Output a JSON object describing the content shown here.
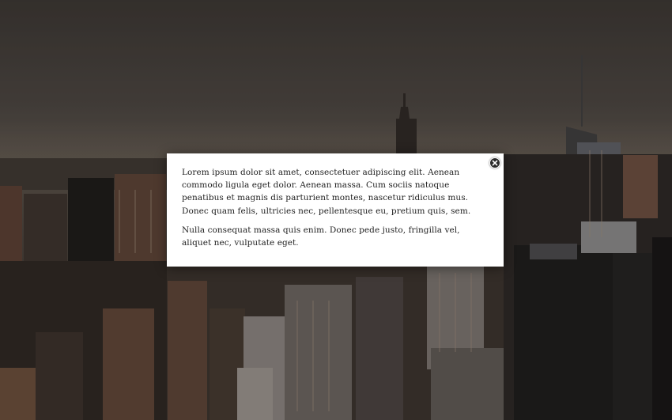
{
  "modal": {
    "paragraphs": [
      "Lorem ipsum dolor sit amet, consectetuer adipiscing elit. Aenean commodo ligula eget dolor. Aenean massa. Cum sociis natoque penatibus et magnis dis parturient montes, nascetur ridiculus mus. Donec quam felis, ultricies nec, pellentesque eu, pretium quis, sem.",
      "Nulla consequat massa quis enim. Donec pede justo, fringilla vel, aliquet nec, vulputate eget."
    ],
    "close_icon": "close-icon"
  },
  "colors": {
    "sky": "#4a4540",
    "city_dark": "#221f1c",
    "city_warm": "#6a4d3a",
    "modal_bg": "#ffffff",
    "text": "#222222"
  }
}
